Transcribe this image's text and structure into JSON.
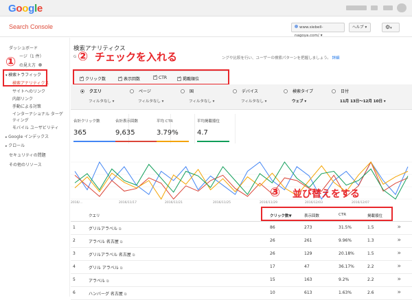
{
  "google_logo": [
    "G",
    "o",
    "o",
    "g",
    "l",
    "e"
  ],
  "app_title": "Search Console",
  "header": {
    "site_selector": "www.siebell-nagoya.com/",
    "help_label": "ヘルプ",
    "settings_icon": "gear-icon"
  },
  "sidebar": {
    "dashboard": "ダッシュボード",
    "messages": "ージ（1 件）",
    "search_appearance": "の見え方",
    "search_traffic": "検索トラフィック",
    "search_analytics": "検索アナリティクス",
    "links_to_site": "サイトへのリンク",
    "internal_links": "内部リンク",
    "manual_actions": "手動による対策",
    "intl_targeting_1": "インターナショナル ターゲ",
    "intl_targeting_2": "ティング",
    "mobile_usability": "モバイル ユーザビリティ",
    "google_index": "Google インデックス",
    "crawl": "クロール",
    "security_issues": "セキュリティの問題",
    "other_resources": "その他のリソース"
  },
  "page": {
    "title": "検索アナリティクス",
    "description_start": "G",
    "description_end": "ングや比較を行い、ユーザーの検索パターンを把握しましょう。",
    "details_link": "詳細"
  },
  "annotations": {
    "step1_number": "①",
    "step2_number": "②",
    "step2_text": "チェックを入れる",
    "step3_number": "③",
    "step3_text": "並び替えをする"
  },
  "metrics": {
    "clicks": "クリック数",
    "impressions": "表示回数",
    "ctr": "CTR",
    "position": "掲載順位"
  },
  "filters": {
    "query": "クエリ",
    "page": "ページ",
    "country": "国",
    "device": "デバイス",
    "search_type": "検索タイプ",
    "date": "日付",
    "no_filter": "フィルタなし",
    "search_type_value": "ウェブ",
    "date_value": "11月 13日～12月 10日"
  },
  "summary": [
    {
      "label": "合計クリック数",
      "value": "365",
      "color": "#4285f4"
    },
    {
      "label": "合計表示回数",
      "value": "9,635",
      "color": "#db4437"
    },
    {
      "label": "平均 CTR",
      "value": "3.79%",
      "color": "#f4a300"
    },
    {
      "label": "平均掲載順位",
      "value": "4.7",
      "color": "#0f9d58"
    }
  ],
  "chart_data": {
    "type": "line",
    "x_tick_labels": [
      "2016/...",
      "2016/11/17",
      "2016/11/21",
      "2016/11/25",
      "2016/11/29",
      "2016/12/03",
      "2016/12/07"
    ],
    "series": [
      {
        "name": "クリック数",
        "color": "#4285f4",
        "values": [
          14,
          10,
          16,
          12,
          15,
          11,
          9,
          14,
          12,
          15,
          10,
          13,
          11,
          9,
          14,
          16,
          12,
          10,
          15,
          13,
          8,
          12,
          14,
          11,
          16,
          12,
          9,
          15
        ]
      },
      {
        "name": "表示回数",
        "color": "#db4437",
        "values": [
          360,
          320,
          280,
          340,
          300,
          310,
          350,
          330,
          270,
          320,
          300,
          340,
          360,
          310,
          280,
          330,
          290,
          350,
          340,
          310,
          300,
          360,
          280,
          320,
          410,
          300,
          330,
          350
        ]
      },
      {
        "name": "CTR",
        "color": "#f4a300",
        "values": [
          3.2,
          3.8,
          3.0,
          4.0,
          3.5,
          3.2,
          3.6,
          2.6,
          3.9,
          3.4,
          4.2,
          3.1,
          3.7,
          3.0,
          3.8,
          3.3,
          4.0,
          3.2,
          2.8,
          3.6,
          4.4,
          3.5,
          3.0,
          3.9,
          4.6,
          3.4,
          3.8,
          4.1
        ]
      },
      {
        "name": "掲載順位",
        "color": "#0f9d58",
        "values": [
          4.5,
          4.9,
          4.2,
          5.1,
          4.6,
          4.4,
          5.3,
          4.7,
          4.1,
          5.0,
          4.8,
          4.3,
          5.2,
          4.6,
          4.0,
          4.9,
          4.5,
          5.4,
          4.7,
          4.3,
          4.9,
          5.0,
          4.4,
          4.6,
          5.1,
          4.2,
          3.8,
          4.8
        ]
      }
    ]
  },
  "table": {
    "columns": [
      "クエリ",
      "クリック数▼",
      "表示回数",
      "CTR",
      "掲載順位"
    ],
    "rows": [
      {
        "n": "1",
        "query": "グリルアラベル",
        "clicks": "86",
        "impr": "273",
        "ctr": "31.5%",
        "pos": "1.5"
      },
      {
        "n": "2",
        "query": "アラベル 名古屋",
        "clicks": "26",
        "impr": "261",
        "ctr": "9.96%",
        "pos": "1.3"
      },
      {
        "n": "3",
        "query": "グリルアラベル 名古屋",
        "clicks": "26",
        "impr": "129",
        "ctr": "20.18%",
        "pos": "1.5"
      },
      {
        "n": "4",
        "query": "グリル アラベル",
        "clicks": "17",
        "impr": "47",
        "ctr": "36.17%",
        "pos": "2.2"
      },
      {
        "n": "5",
        "query": "アラベル",
        "clicks": "15",
        "impr": "163",
        "ctr": "9.2%",
        "pos": "2.2"
      },
      {
        "n": "6",
        "query": "ハンバーグ 名古屋",
        "clicks": "10",
        "impr": "613",
        "ctr": "1.63%",
        "pos": "2.6"
      }
    ]
  }
}
